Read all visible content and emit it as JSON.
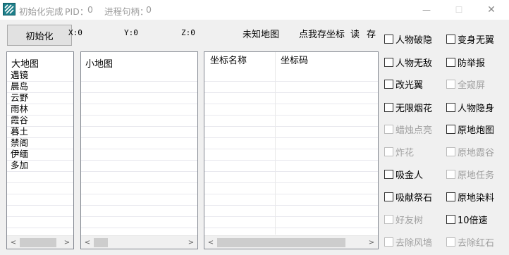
{
  "window": {
    "title": "初始化完成",
    "pid_label": "PID：",
    "pid_value": "0",
    "handle_label": "进程句柄：",
    "handle_value": "0",
    "minimize_glyph": "—",
    "maximize_glyph": "☐",
    "close_glyph": "✕"
  },
  "toolbar": {
    "init_label": "初始化",
    "x_label": "X:0",
    "y_label": "Y:0",
    "z_label": "Z:0",
    "unknown_map_label": "未知地图",
    "save_coord_label": "点我存坐标",
    "read_label": "读",
    "save_label": "存"
  },
  "big_map": {
    "header": "大地图",
    "items": [
      "遇镜",
      "晨岛",
      "云野",
      "雨林",
      "霞谷",
      "暮土",
      "禁阁",
      "伊缅",
      "多加"
    ]
  },
  "small_map": {
    "header": "小地图"
  },
  "coord_table": {
    "col_name": "坐标名称",
    "col_code": "坐标码"
  },
  "scroll": {
    "left": "<",
    "right": ">"
  },
  "options": [
    {
      "label": "人物破隐",
      "enabled": true
    },
    {
      "label": "变身无翼",
      "enabled": true
    },
    {
      "label": "人物无敌",
      "enabled": true
    },
    {
      "label": "防举报",
      "enabled": true
    },
    {
      "label": "改光翼",
      "enabled": true
    },
    {
      "label": "全窥屏",
      "enabled": false
    },
    {
      "label": "无限烟花",
      "enabled": true
    },
    {
      "label": "人物隐身",
      "enabled": true
    },
    {
      "label": "蜡烛点亮",
      "enabled": false
    },
    {
      "label": "原地炮图",
      "enabled": true
    },
    {
      "label": "炸花",
      "enabled": false
    },
    {
      "label": "原地霞谷",
      "enabled": false
    },
    {
      "label": "吸金人",
      "enabled": true
    },
    {
      "label": "原地任务",
      "enabled": false
    },
    {
      "label": "吸献祭石",
      "enabled": true
    },
    {
      "label": "原地染料",
      "enabled": true
    },
    {
      "label": "好友树",
      "enabled": false
    },
    {
      "label": "10倍速",
      "enabled": true
    },
    {
      "label": "去除风墙",
      "enabled": false
    },
    {
      "label": "去除红石",
      "enabled": false
    }
  ]
}
